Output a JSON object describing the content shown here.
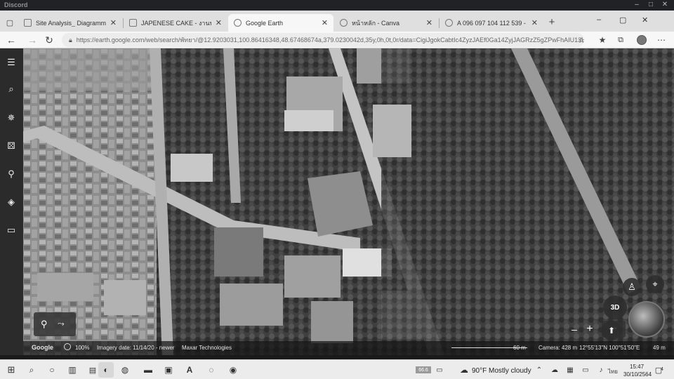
{
  "discord": {
    "title": "Discord"
  },
  "tabs": [
    {
      "label": "Site Analysis_ Diagramming Inf"
    },
    {
      "label": "JAPENESE CAKE - งานนำเสนอ (16"
    },
    {
      "label": "Google Earth"
    },
    {
      "label": "หน้าหลัก - Canva"
    },
    {
      "label": "A 096 097 104 112 539 - งานนำ"
    }
  ],
  "address": {
    "url": "https://earth.google.com/web/search/พัทยา/@12.9203031,100.86416348,48.67468674a,379.0230042d,35y,0h,0t,0r/data=CigiJgokCabtIc4ZyzJAEf0Ga14ZyjJAGRzZ5gZPwFhAIU13U..."
  },
  "status": {
    "logo": "Google",
    "zoom": "100%",
    "imagery": "Imagery date: 11/14/20 - newer",
    "provider": "Maxar Technologies",
    "scale": "60 m",
    "camera": "Camera: 428 m",
    "coords": "12°55'13\"N 100°51'50\"E",
    "elevation": "49 m"
  },
  "controls": {
    "mode3d": "3D",
    "zoom_out": "−",
    "zoom_in": "+"
  },
  "taskbar": {
    "weather": "90°F  Mostly cloudy",
    "time": "15:47",
    "date": "30/10/2564",
    "lang": "ไทย",
    "notif": "4",
    "tray_badge": "66.6"
  }
}
